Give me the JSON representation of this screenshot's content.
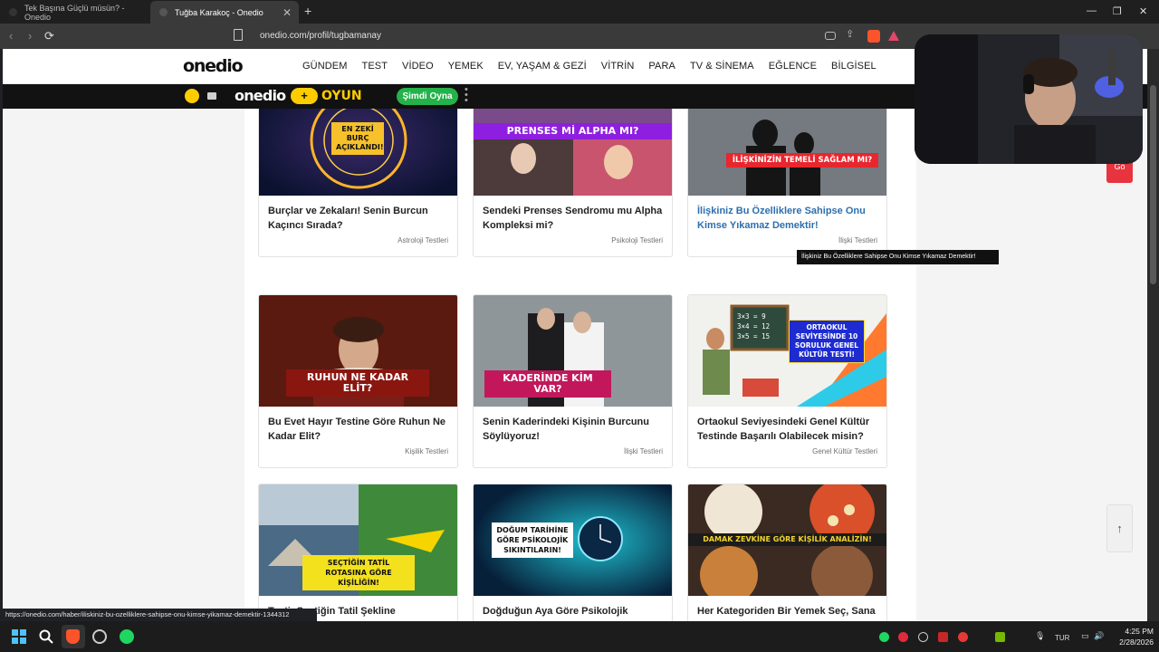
{
  "browser": {
    "tabs": [
      {
        "title": "Tek Başına Güçlü müsün? - Onedio"
      },
      {
        "title": "Tuğba Karakoç - Onedio"
      }
    ],
    "url": "onedio.com/profil/tugbamanay",
    "status_url": "https://onedio.com/haber/iliskiniz-bu-ozelliklere-sahipse-onu-kimse-yikamaz-demektir-1344312"
  },
  "header": {
    "logo": "onedio",
    "menu": [
      "GÜNDEM",
      "TEST",
      "VİDEO",
      "YEMEK",
      "EV, YAŞAM & GEZİ",
      "VİTRİN",
      "PARA",
      "TV & SİNEMA",
      "EĞLENCE",
      "BİLGİSEL"
    ]
  },
  "oyun_bar": {
    "logo": "onedio",
    "plus": "+",
    "word": "OYUN",
    "cta": "Şimdi Oyna"
  },
  "cards": [
    {
      "tag": "EN ZEKİ BURÇ AÇIKLANDI!",
      "title": "Burçlar ve Zekaları! Senin Burcun Kaçıncı Sırada?",
      "category": "Astroloji Testleri"
    },
    {
      "tag": "PRENSES Mİ ALPHA MI?",
      "title": "Sendeki Prenses Sendromu mu Alpha Kompleksi mi?",
      "category": "Psikoloji Testleri"
    },
    {
      "tag": "İLİŞKİNİZİN TEMELİ SAĞLAM MI?",
      "title": "İlişkiniz Bu Özelliklere Sahipse Onu Kimse Yıkamaz Demektir!",
      "category": "İlişki Testleri"
    },
    {
      "tag": "RUHUN NE KADAR ELİT?",
      "title": "Bu Evet Hayır Testine Göre Ruhun Ne Kadar Elit?",
      "category": "Kişilik Testleri"
    },
    {
      "tag": "KADERİNDE KİM VAR?",
      "title": "Senin Kaderindeki Kişinin Burcunu Söylüyoruz!",
      "category": "İlişki Testleri"
    },
    {
      "tag": "ORTAOKUL SEVİYESİNDE 10 SORULUK GENEL KÜLTÜR TESTİ!",
      "title": "Ortaokul Seviyesindeki Genel Kültür Testinde Başarılı Olabilecek misin?",
      "category": "Genel Kültür Testleri"
    },
    {
      "tag": "SEÇTİĞİN TATİL ROTASINA GÖRE KİŞİLİĞİN!",
      "title": "Testi: Seçtiğin Tatil Şekline",
      "category": ""
    },
    {
      "tag": "DOĞUM TARİHİNE GÖRE PSİKOLOJİK SIKINTILARIN!",
      "title": "Doğduğun Aya Göre Psikolojik Sıkıntın",
      "category": ""
    },
    {
      "tag": "DAMAK ZEVKİNE GÖRE KİŞİLİK ANALİZİN!",
      "title": "Her Kategoriden Bir Yemek Seç, Sana",
      "category": ""
    }
  ],
  "blackboard": [
    "3×3 = 9",
    "3×4 = 12",
    "3×5 = 15"
  ],
  "tooltip": "İlişkiniz Bu Özelliklere Sahipse Onu Kimse Yıkamaz Demektir!",
  "side_button": "Gö",
  "taskbar": {
    "lang": "TUR",
    "time": "4:25 PM",
    "date": "2/28/2026"
  }
}
